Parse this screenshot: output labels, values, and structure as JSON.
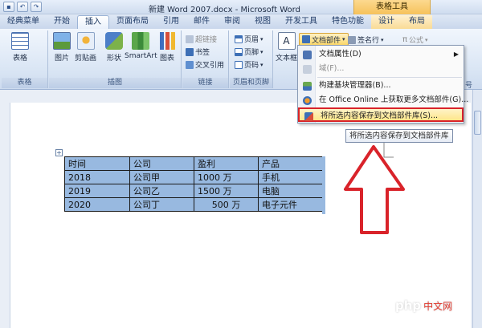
{
  "window": {
    "title": "新建 Word 2007.docx - Microsoft Word",
    "contextual_tab_group": "表格工具",
    "quick_access": [
      "save-icon",
      "undo-icon",
      "redo-icon"
    ]
  },
  "tabs": [
    "经典菜单",
    "开始",
    "插入",
    "页面布局",
    "引用",
    "邮件",
    "审阅",
    "视图",
    "开发工具",
    "特色功能",
    "设计",
    "布局"
  ],
  "active_tab": "插入",
  "ribbon": {
    "groups": {
      "tables": {
        "label": "表格",
        "buttons": [
          "表格"
        ]
      },
      "illustrations": {
        "label": "插图",
        "buttons": [
          "图片",
          "剪贴画",
          "形状",
          "SmartArt",
          "图表"
        ]
      },
      "links": {
        "label": "链接",
        "buttons": [
          "超链接",
          "书签",
          "交叉引用"
        ]
      },
      "header_footer": {
        "label": "页眉和页脚",
        "buttons": [
          "页眉",
          "页脚",
          "页码"
        ]
      },
      "text": {
        "buttons": [
          "文本框",
          "文档部件",
          "签名行",
          "公式"
        ],
        "partial_label": "号"
      }
    }
  },
  "menu": {
    "items": [
      {
        "label": "文档属性(D)",
        "has_submenu": true,
        "enabled": true
      },
      {
        "label": "域(F)...",
        "has_submenu": false,
        "enabled": false
      },
      {
        "label": "构建基块管理器(B)...",
        "has_submenu": false,
        "enabled": true
      },
      {
        "label": "在 Office Online 上获取更多文档部件(G)...",
        "has_submenu": false,
        "enabled": true
      },
      {
        "label": "将所选内容保存到文档部件库(S)...",
        "has_submenu": false,
        "enabled": true,
        "highlighted": true
      }
    ]
  },
  "tooltip": "将所选内容保存到文档部件库",
  "table": {
    "header": [
      "时间",
      "公司",
      "盈利",
      "产品"
    ],
    "rows": [
      [
        "2018",
        "公司甲",
        "1000 万",
        "手机"
      ],
      [
        "2019",
        "公司乙",
        "1500 万",
        "电脑"
      ],
      [
        "2020",
        "公司丁",
        "500 万",
        "电子元件"
      ]
    ]
  },
  "watermark": {
    "site": "php",
    "suffix": "中文网"
  },
  "colors": {
    "highlight_border": "#d9232a",
    "selection": "#98b9e0",
    "ribbon_accent": "#1f3a66"
  }
}
